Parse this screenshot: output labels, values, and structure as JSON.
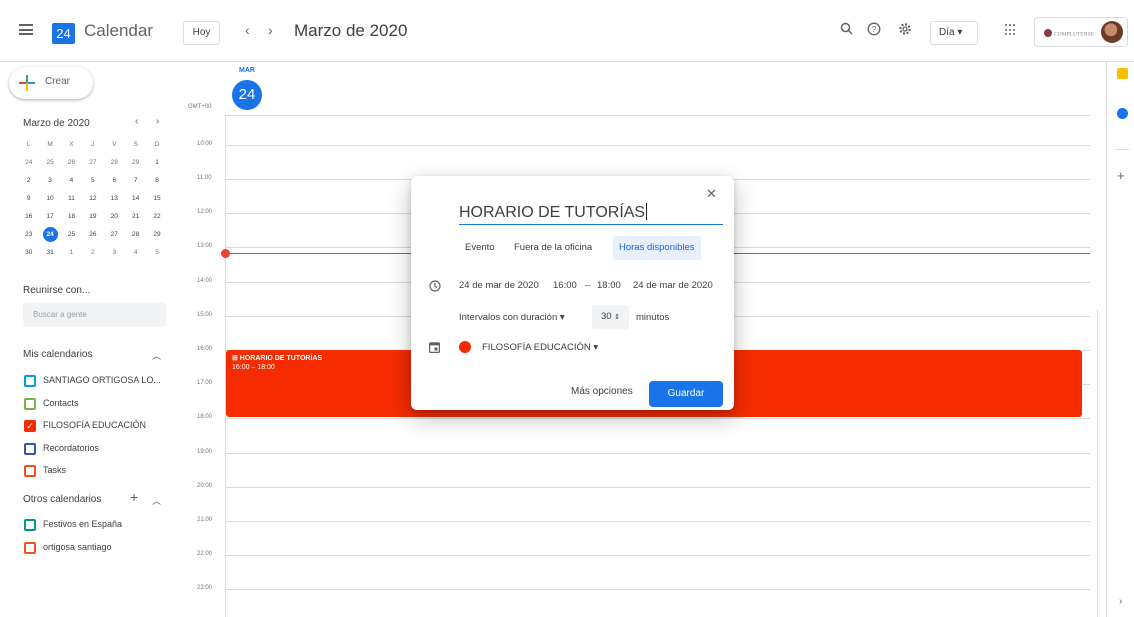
{
  "app": {
    "name": "Calendar",
    "logo_day": "24"
  },
  "header": {
    "today_button": "Hoy",
    "prev": "‹",
    "next": "›",
    "title": "Marzo de 2020",
    "view_select": "Día ▾",
    "account_seal_text": "COMPLUTENSE"
  },
  "sidebar": {
    "create_label": "Crear",
    "mini_cal": {
      "title": "Marzo de 2020",
      "weekdays": [
        "L",
        "M",
        "X",
        "J",
        "V",
        "S",
        "D"
      ],
      "weeks": [
        [
          "24",
          "25",
          "26",
          "27",
          "28",
          "29",
          "1"
        ],
        [
          "2",
          "3",
          "4",
          "5",
          "6",
          "7",
          "8"
        ],
        [
          "9",
          "10",
          "11",
          "12",
          "13",
          "14",
          "15"
        ],
        [
          "16",
          "17",
          "18",
          "19",
          "20",
          "21",
          "22"
        ],
        [
          "23",
          "24",
          "25",
          "26",
          "27",
          "28",
          "29"
        ],
        [
          "30",
          "31",
          "1",
          "2",
          "3",
          "4",
          "5"
        ]
      ],
      "today": "24"
    },
    "meet_title": "Reunirse con...",
    "people_search_placeholder": "Buscar a gente",
    "my_calendars_title": "Mis calendarios",
    "my_calendars": [
      {
        "label": "SANTIAGO ORTIGOSA LO...",
        "color": "#039be5",
        "checked": false
      },
      {
        "label": "Contacts",
        "color": "#7cb342",
        "checked": false
      },
      {
        "label": "FILOSOFÍA EDUCACIÓN",
        "color": "#f42c00",
        "checked": true
      },
      {
        "label": "Recordatorios",
        "color": "#3f51b5",
        "checked": false
      },
      {
        "label": "Tasks",
        "color": "#f4511e",
        "checked": false
      }
    ],
    "other_calendars_title": "Otros calendarios",
    "other_calendars": [
      {
        "label": "Festivos en España",
        "color": "#009688",
        "checked": false
      },
      {
        "label": "ortigosa santiago",
        "color": "#f4511e",
        "checked": false
      }
    ]
  },
  "day_view": {
    "dow": "MAR",
    "day_number": "24",
    "timezone": "GMT+00",
    "hours": [
      "10:00",
      "11:00",
      "12:00",
      "13:00",
      "14:00",
      "15:00",
      "16:00",
      "17:00",
      "18:00",
      "19:00",
      "20:00",
      "21:00",
      "22:00",
      "23:00"
    ],
    "event": {
      "title": "⊞ HORARIO DE TUTORÍAS",
      "time": "16:00 – 18:00",
      "color": "#f42c00"
    }
  },
  "dialog": {
    "close": "✕",
    "title_value": "HORARIO DE TUTORÍAS",
    "tabs": [
      "Evento",
      "Fuera de la oficina",
      "Horas disponibles"
    ],
    "active_tab": "Horas disponibles",
    "start_date": "24 de mar de 2020",
    "start_time": "16:00",
    "dash": "–",
    "end_time": "18:00",
    "end_date": "24 de mar de 2020",
    "slots_label": "Intervalos con duración ▾",
    "slot_value": "30",
    "slot_unit": "minutos",
    "calendar_name": "FILOSOFÍA EDUCACIÓN ▾",
    "more_options": "Más opciones",
    "save": "Guardar"
  },
  "colors": {
    "accent": "#1a73e8",
    "event": "#f42c00",
    "now_line": "#ea4335"
  }
}
